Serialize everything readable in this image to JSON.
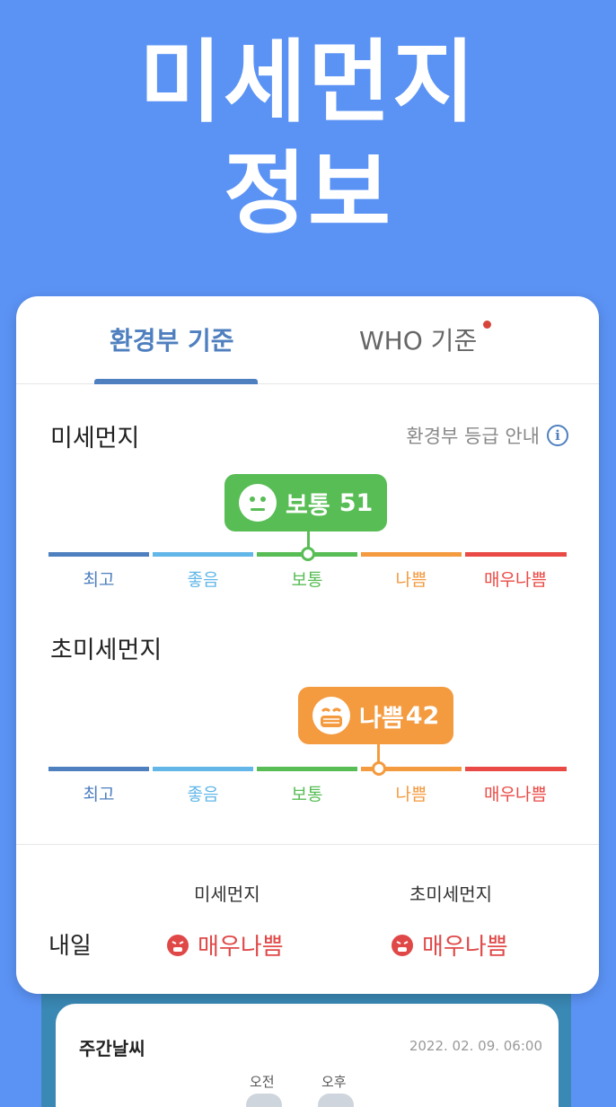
{
  "hero": {
    "line1": "미세먼지",
    "line2": "정보"
  },
  "tabs": [
    {
      "label": "환경부 기준",
      "active": true
    },
    {
      "label": "WHO 기준",
      "active": false,
      "has_badge": true
    }
  ],
  "pm10": {
    "title": "미세먼지",
    "guide_label": "환경부 등급 안내",
    "status": "보통",
    "value": "51",
    "color": "#58bd55"
  },
  "pm25": {
    "title": "초미세먼지",
    "status": "나쁨",
    "value": "42",
    "color": "#f49a3f"
  },
  "scale_labels": [
    "최고",
    "좋음",
    "보통",
    "나쁨",
    "매우나쁨"
  ],
  "scale_colors": [
    "#4e7fbf",
    "#62b7e8",
    "#58bd55",
    "#f49a3f",
    "#ea4a45"
  ],
  "tomorrow": {
    "label": "내일",
    "pm10_header": "미세먼지",
    "pm25_header": "초미세먼지",
    "pm10_status": "매우나쁨",
    "pm25_status": "매우나쁨"
  },
  "weekly": {
    "title": "주간날씨",
    "datetime": "2022. 02. 09. 06:00",
    "am_label": "오전",
    "pm_label": "오후"
  }
}
